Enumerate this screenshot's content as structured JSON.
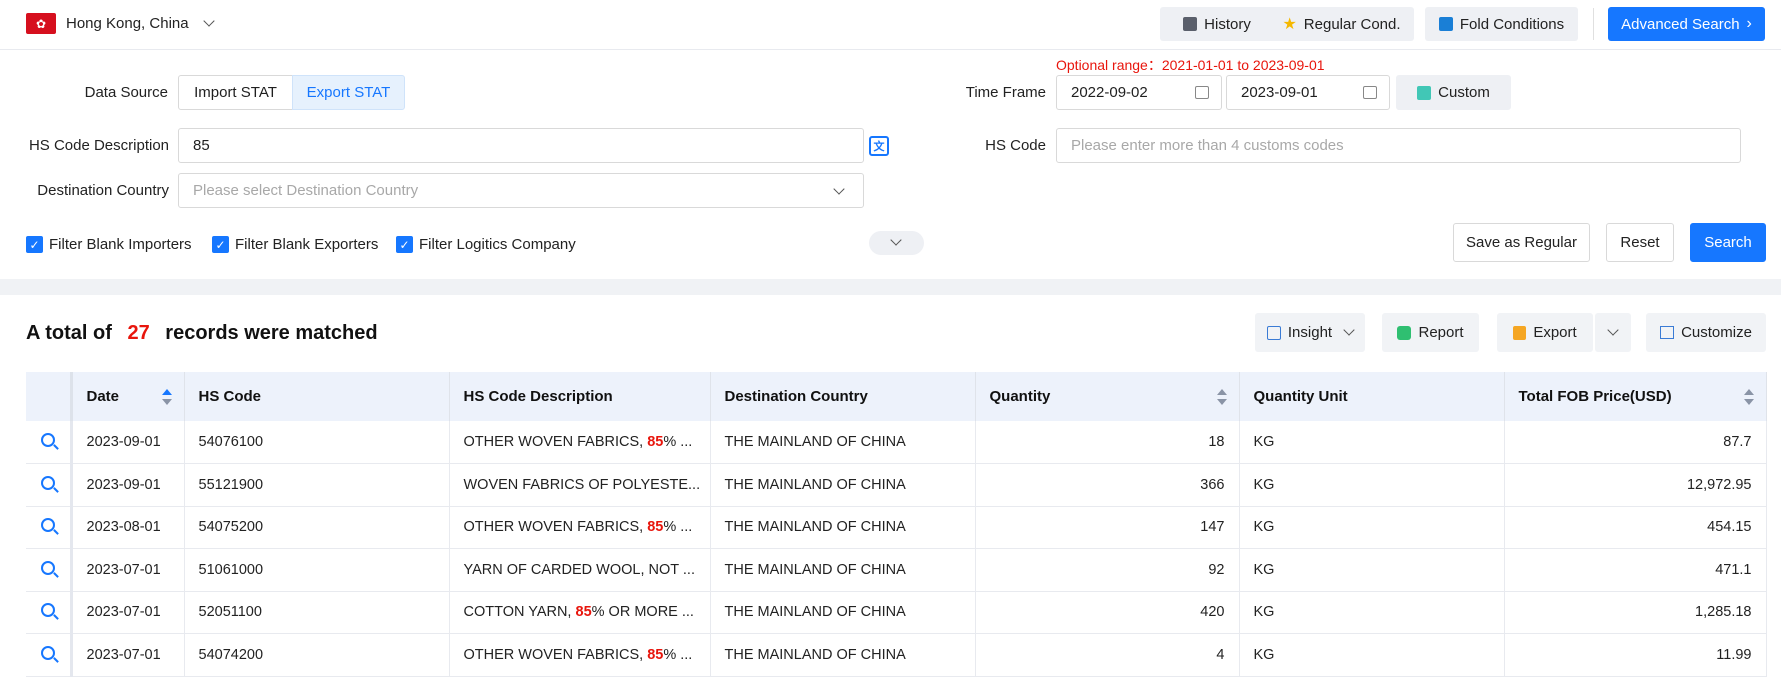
{
  "header": {
    "region": "Hong Kong, China",
    "history": "History",
    "regular_cond": "Regular Cond.",
    "fold_conditions": "Fold Conditions",
    "advanced_search": "Advanced Search"
  },
  "form": {
    "data_source_label": "Data Source",
    "import_stat": "Import STAT",
    "export_stat": "Export STAT",
    "optional_range": "Optional range：2021-01-01 to 2023-09-01",
    "time_frame_label": "Time Frame",
    "date_from": "2022-09-02",
    "date_to": "2023-09-01",
    "custom": "Custom",
    "hs_desc_label": "HS Code Description",
    "hs_desc_value": "85",
    "hs_code_label": "HS Code",
    "hs_code_placeholder": "Please enter more than 4 customs codes",
    "dest_country_label": "Destination Country",
    "dest_country_placeholder": "Please select Destination Country",
    "filter_importers": "Filter Blank Importers",
    "filter_exporters": "Filter Blank Exporters",
    "filter_logistics": "Filter Logitics Company",
    "save_regular": "Save as Regular",
    "reset": "Reset",
    "search": "Search"
  },
  "results": {
    "prefix": "A total of",
    "count": "27",
    "suffix": "records were matched",
    "insight": "Insight",
    "report": "Report",
    "export": "Export",
    "customize": "Customize"
  },
  "table": {
    "columns": [
      "Date",
      "HS Code",
      "HS Code Description",
      "Destination Country",
      "Quantity",
      "Quantity Unit",
      "Total FOB Price(USD)"
    ],
    "rows": [
      {
        "date": "2023-09-01",
        "hs": "54076100",
        "desc_pre": "OTHER WOVEN FABRICS, ",
        "desc_hl": "85",
        "desc_post": "% ...",
        "country": "THE MAINLAND OF CHINA",
        "qty": "18",
        "unit": "KG",
        "price": "87.7"
      },
      {
        "date": "2023-09-01",
        "hs": "55121900",
        "desc_pre": "WOVEN FABRICS OF POLYESTE...",
        "desc_hl": "",
        "desc_post": "",
        "country": "THE MAINLAND OF CHINA",
        "qty": "366",
        "unit": "KG",
        "price": "12,972.95"
      },
      {
        "date": "2023-08-01",
        "hs": "54075200",
        "desc_pre": "OTHER WOVEN FABRICS, ",
        "desc_hl": "85",
        "desc_post": "% ...",
        "country": "THE MAINLAND OF CHINA",
        "qty": "147",
        "unit": "KG",
        "price": "454.15"
      },
      {
        "date": "2023-07-01",
        "hs": "51061000",
        "desc_pre": "YARN OF CARDED WOOL, NOT ...",
        "desc_hl": "",
        "desc_post": "",
        "country": "THE MAINLAND OF CHINA",
        "qty": "92",
        "unit": "KG",
        "price": "471.1"
      },
      {
        "date": "2023-07-01",
        "hs": "52051100",
        "desc_pre": "COTTON YARN, ",
        "desc_hl": "85",
        "desc_post": "% OR MORE ...",
        "country": "THE MAINLAND OF CHINA",
        "qty": "420",
        "unit": "KG",
        "price": "1,285.18"
      },
      {
        "date": "2023-07-01",
        "hs": "54074200",
        "desc_pre": "OTHER WOVEN FABRICS, ",
        "desc_hl": "85",
        "desc_post": "% ...",
        "country": "THE MAINLAND OF CHINA",
        "qty": "4",
        "unit": "KG",
        "price": "11.99"
      }
    ]
  }
}
